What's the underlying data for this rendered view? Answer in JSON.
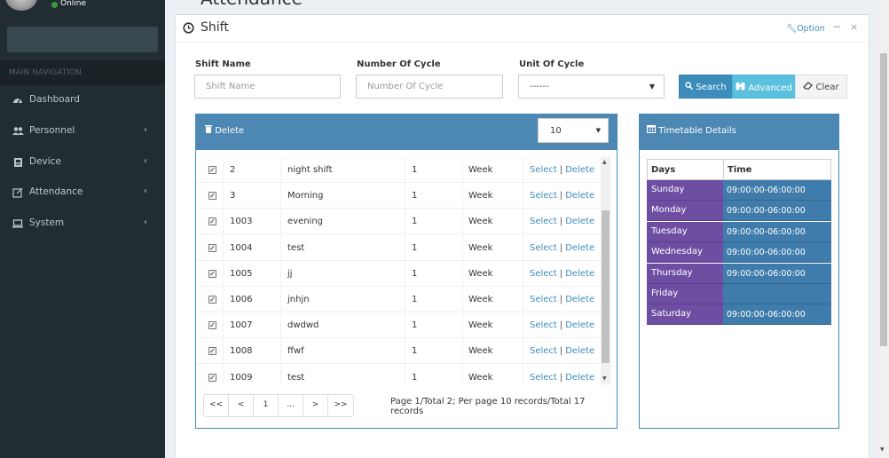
{
  "user": {
    "status": "Online"
  },
  "sidebar": {
    "header": "MAIN NAVIGATION",
    "items": [
      {
        "label": "Dashboard",
        "icon": "dashboard-icon"
      },
      {
        "label": "Personnel",
        "icon": "users-icon"
      },
      {
        "label": "Device",
        "icon": "device-icon"
      },
      {
        "label": "Attendance",
        "icon": "attendance-icon"
      },
      {
        "label": "System",
        "icon": "monitor-icon"
      }
    ]
  },
  "page": {
    "title": "Attendance"
  },
  "box": {
    "title": "Shift",
    "option_label": "Option",
    "minimize": "−",
    "close": "×"
  },
  "filters": {
    "shift_name": {
      "label": "Shift Name",
      "placeholder": "Shift Name"
    },
    "cycle": {
      "label": "Number Of Cycle",
      "placeholder": "Number Of Cycle"
    },
    "unit": {
      "label": "Unit Of Cycle",
      "value": "------"
    }
  },
  "buttons": {
    "search": "Search",
    "advanced": "Advanced",
    "clear": "Clear"
  },
  "table": {
    "delete_label": "Delete",
    "page_size": "10",
    "rows": [
      {
        "id": "2",
        "name": "night shift",
        "cycle": "1",
        "unit": "Week",
        "select": "Select",
        "delete": "Delete"
      },
      {
        "id": "3",
        "name": "Morning",
        "cycle": "1",
        "unit": "Week",
        "select": "Select",
        "delete": "Delete"
      },
      {
        "id": "1003",
        "name": "evening",
        "cycle": "1",
        "unit": "Week",
        "select": "Select",
        "delete": "Delete"
      },
      {
        "id": "1004",
        "name": "test",
        "cycle": "1",
        "unit": "Week",
        "select": "Select",
        "delete": "Delete"
      },
      {
        "id": "1005",
        "name": "jj",
        "cycle": "1",
        "unit": "Week",
        "select": "Select",
        "delete": "Delete"
      },
      {
        "id": "1006",
        "name": "jnhjn",
        "cycle": "1",
        "unit": "Week",
        "select": "Select",
        "delete": "Delete"
      },
      {
        "id": "1007",
        "name": "dwdwd",
        "cycle": "1",
        "unit": "Week",
        "select": "Select",
        "delete": "Delete"
      },
      {
        "id": "1008",
        "name": "ffwf",
        "cycle": "1",
        "unit": "Week",
        "select": "Select",
        "delete": "Delete"
      },
      {
        "id": "1009",
        "name": "test",
        "cycle": "1",
        "unit": "Week",
        "select": "Select",
        "delete": "Delete"
      }
    ],
    "pager": {
      "first": "<<",
      "prev": "<",
      "page": "1",
      "ellipsis": "...",
      "next": ">",
      "last": ">>"
    },
    "page_info": "Page 1/Total 2; Per page 10 records/Total 17 records"
  },
  "timetable": {
    "title": "Timetable Details",
    "col_days": "Days",
    "col_time": "Time",
    "rows": [
      {
        "day": "Sunday",
        "time": "09:00:00-06:00:00"
      },
      {
        "day": "Monday",
        "time": "09:00:00-06:00:00"
      },
      {
        "day": "Tuesday",
        "time": "09:00:00-06:00:00"
      },
      {
        "day": "Wednesday",
        "time": "09:00:00-06:00:00"
      },
      {
        "day": "Thursday",
        "time": "09:00:00-06:00:00"
      },
      {
        "day": "Friday",
        "time": ""
      },
      {
        "day": "Saturday",
        "time": "09:00:00-06:00:00"
      }
    ]
  },
  "colors": {
    "sidebar": "#222d32",
    "primary": "#3c8dbc",
    "info": "#5bc0de",
    "day_cell": "#6d4ea3",
    "time_cell": "#3f7cac"
  }
}
